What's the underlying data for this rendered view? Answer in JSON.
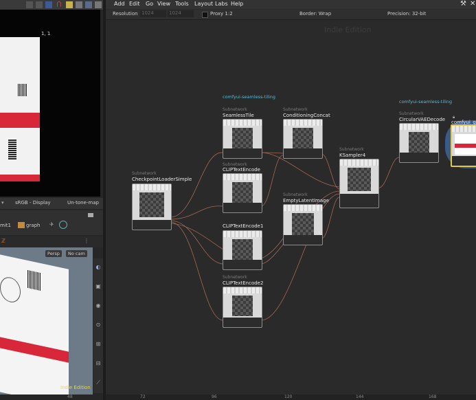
{
  "menu": [
    "Add",
    "Edit",
    "Go",
    "View",
    "Tools",
    "Layout",
    "Labs",
    "Help"
  ],
  "toolbar": {
    "resolution_label": "Resolution",
    "res_w": "1024",
    "res_h": "1024",
    "proxy": "Proxy 1:2",
    "border": "Border: Wrap",
    "precision": "Precision: 32-bit"
  },
  "watermark": "Indie Edition",
  "left": {
    "coord": "1, 1",
    "display": "sRGB - Display",
    "tonemap": "Un-tone-map",
    "path_left": "mit1",
    "path_graph": "graph",
    "persp": "Persp",
    "cam": "No cam",
    "indie": "Indie Edition"
  },
  "nodes": [
    {
      "sub": "Subnetwork",
      "title": "CheckpointLoaderSimple"
    },
    {
      "tag": "comfyui-seamless-tiling",
      "sub": "Subnetwork",
      "title": "SeamlessTile"
    },
    {
      "sub": "Subnetwork",
      "title": "ConditioningConcat"
    },
    {
      "sub": "Subnetwork",
      "title": "CLIPTextEncode"
    },
    {
      "sub": "Subnetwork",
      "title": "EmptyLatentImage"
    },
    {
      "sub": "Subnetwork",
      "title": "KSampler4"
    },
    {
      "sub": "Subnetwork",
      "title": "CLIPTextEncode1"
    },
    {
      "sub": "Subnetwork",
      "title": "CLIPTextEncode2"
    },
    {
      "tag": "comfyui-seamless-tiling",
      "sub": "Subnetwork",
      "title": "CircularVAEDecode"
    },
    {
      "title": "comfyui_gr"
    }
  ],
  "ruler": [
    "48",
    "72",
    "96",
    "120",
    "144",
    "168"
  ],
  "icons": [
    "wrench-icon",
    "close-icon"
  ]
}
